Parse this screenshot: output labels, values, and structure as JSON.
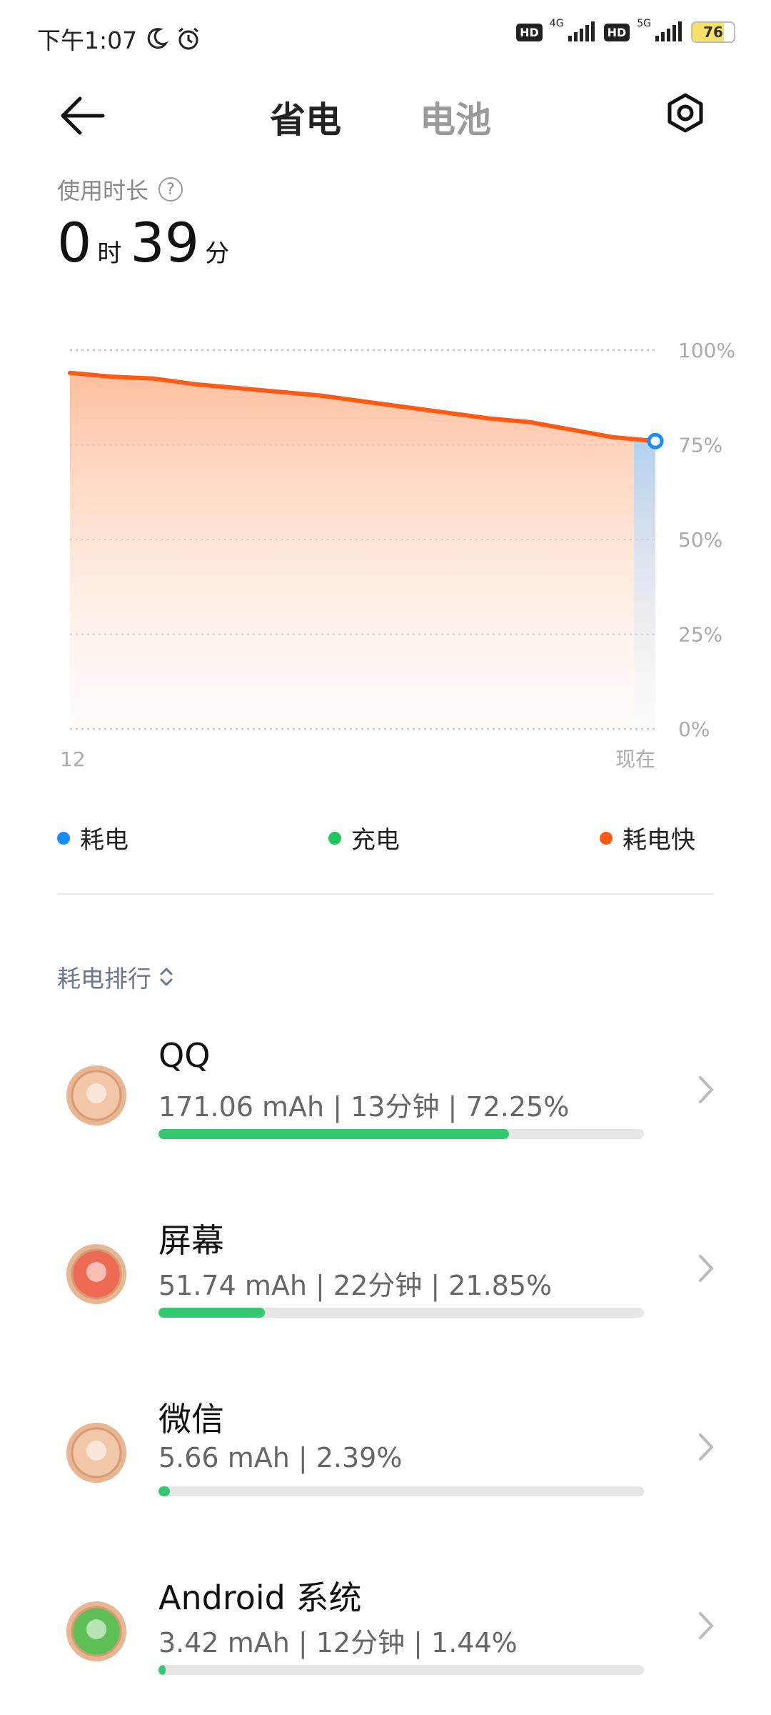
{
  "status_bar": {
    "time": "下午1:07",
    "net1": "4G",
    "net2": "5G",
    "hd": "HD",
    "battery": "76"
  },
  "header": {
    "tab_active": "省电",
    "tab_inactive": "电池"
  },
  "usage": {
    "label": "使用时长",
    "help": "?",
    "hours": "0",
    "hours_unit": "时",
    "minutes": "39",
    "minutes_unit": "分"
  },
  "chart_data": {
    "type": "area",
    "x": [
      "12",
      "现在"
    ],
    "y_ticks": [
      "100%",
      "75%",
      "50%",
      "25%",
      "0%"
    ],
    "series": [
      {
        "name": "耗电快",
        "values": [
          94,
          93,
          92.5,
          91,
          90,
          89,
          88,
          86.5,
          85,
          83.5,
          82,
          81,
          79,
          77,
          76
        ]
      }
    ],
    "ylim": [
      0,
      100
    ],
    "colors": {
      "line": "#ff5a14",
      "current": "#1a8cff"
    }
  },
  "legend": [
    {
      "label": "耗电",
      "color": "#1a8cff"
    },
    {
      "label": "充电",
      "color": "#1fc55a"
    },
    {
      "label": "耗电快",
      "color": "#ff5a14"
    }
  ],
  "ranking": {
    "label": "耗电排行"
  },
  "apps": [
    {
      "name": "QQ",
      "stats": "171.06 mAh | 13分钟 | 72.25%",
      "percent": 72.25,
      "icon_color": "#f1c7a8",
      "icon": "qq-icon"
    },
    {
      "name": "屏幕",
      "stats": "51.74 mAh | 22分钟 | 21.85%",
      "percent": 21.85,
      "icon_color": "#ee6a55",
      "icon": "screen-icon"
    },
    {
      "name": "微信",
      "stats": "5.66 mAh | 2.39%",
      "percent": 2.39,
      "icon_color": "#f1c7a8",
      "icon": "wechat-icon"
    },
    {
      "name": "Android 系统",
      "stats": "3.42 mAh | 12分钟 | 1.44%",
      "percent": 1.44,
      "icon_color": "#5fbf57",
      "icon": "android-icon"
    }
  ]
}
